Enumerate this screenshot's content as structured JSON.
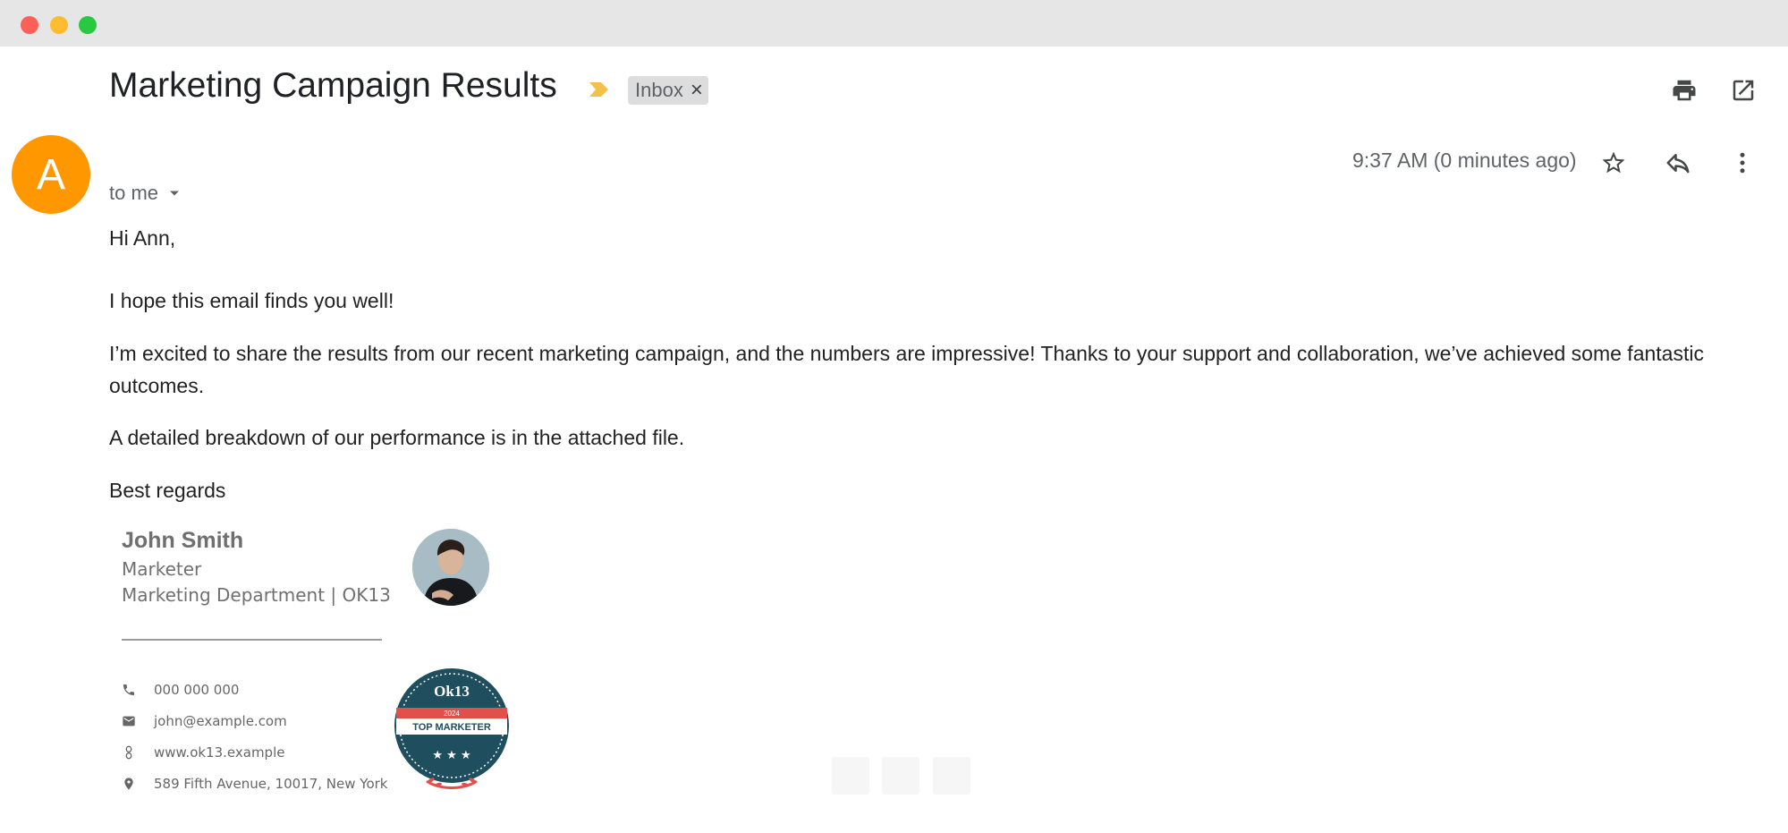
{
  "email": {
    "subject": "Marketing Campaign Results",
    "label_chip": "Inbox",
    "label_chip_remove": "×",
    "sender_initial": "A",
    "recipient": "to me",
    "timestamp": "9:37 AM (0 minutes ago)"
  },
  "body": {
    "greeting": "Hi Ann,",
    "paragraphs": [
      "I hope this email finds you well!",
      "I’m excited to share the results from our recent marketing campaign, and the numbers are impressive! Thanks to your support and collaboration, we’ve achieved some fantastic outcomes.",
      "A detailed breakdown of our performance is in the attached file."
    ],
    "signoff": "Best regards"
  },
  "signature": {
    "name": "John Smith",
    "title": "Marketer",
    "department": "Marketing Department | OK13",
    "phone": "000 000 000",
    "email": "john@example.com",
    "website": "www.ok13.example",
    "address": "589 Fifth Avenue, 10017, New York",
    "badge": {
      "brand": "Ok13",
      "year": "2024",
      "label": "TOP MARKETER"
    }
  },
  "icons": {
    "header_actions": [
      "print-icon",
      "open-in-new-window-icon"
    ],
    "message_actions": [
      "star-icon",
      "reply-icon",
      "more-vert-icon"
    ],
    "contact": [
      "phone-icon",
      "email-icon",
      "link-icon",
      "location-pin-icon"
    ]
  },
  "colors": {
    "avatar": "#ff9800",
    "important_marker": "#f4c04a",
    "chip_background": "#dddddd",
    "badge_teal": "#1f4e5f",
    "badge_red": "#e2504c"
  }
}
